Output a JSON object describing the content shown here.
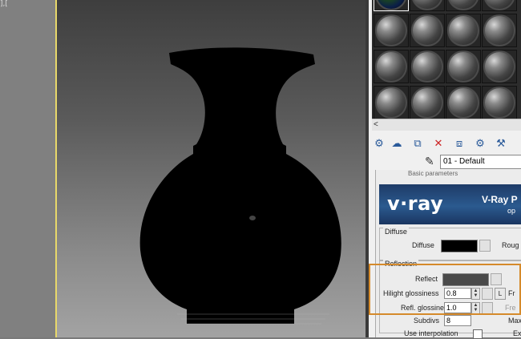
{
  "viewport": {
    "corner_text": "],["
  },
  "material_editor": {
    "slot_rows": 4,
    "slot_cols": 4,
    "selected_slot": 0,
    "material_name": "01 - Default",
    "rollout_title": "Basic parameters",
    "banner": {
      "logo": "v·ray",
      "title": "V-Ray P",
      "subtitle": "op"
    },
    "diffuse": {
      "group_label": "Diffuse",
      "label": "Diffuse",
      "color": "#000000",
      "side_label": "Roug"
    },
    "reflection": {
      "group_label": "Reflection",
      "reflect_label": "Reflect",
      "reflect_color": "#4a4a4a",
      "hilight_label": "Hilight glossiness",
      "hilight_value": "0.8",
      "refl_label": "Refl. glossiness",
      "refl_value": "1.0",
      "l_button": "L",
      "fr_label": "Fr",
      "fre_label": "Fre",
      "subdivs_label": "Subdivs",
      "subdivs_value": "8",
      "max_label": "Max",
      "interp_label": "Use interpolation",
      "ex_label": "Ex"
    },
    "highlight_color": "#d58a2b"
  }
}
